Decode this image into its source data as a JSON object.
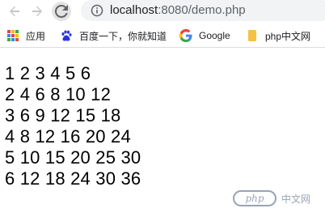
{
  "address_bar": {
    "url_host": "localhost",
    "url_rest": ":8080/demo.php"
  },
  "bookmarks": [
    {
      "label": "应用",
      "icon": "apps-grid-icon"
    },
    {
      "label": "百度一下，你就知道",
      "icon": "baidu-paw-icon"
    },
    {
      "label": "Google",
      "icon": "google-g-icon"
    },
    {
      "label": "php中文网",
      "icon": "folder-icon"
    }
  ],
  "page": {
    "rows": [
      "1 2 3 4 5 6",
      "2 4 6 8 10 12",
      "3 6 9 12 15 18",
      "4 8 12 16 20 24",
      "5 10 15 20 25 30",
      "6 12 18 24 30 36"
    ]
  },
  "watermark": {
    "logo_text": "php",
    "text": "中文网"
  },
  "colors": {
    "reload_bg": "#e3e3e3",
    "omnibox_bg": "#f1f3f4",
    "icon_grey": "#5f6368",
    "folder_yellow": "#f6c244",
    "baidu_blue": "#2932e1"
  }
}
